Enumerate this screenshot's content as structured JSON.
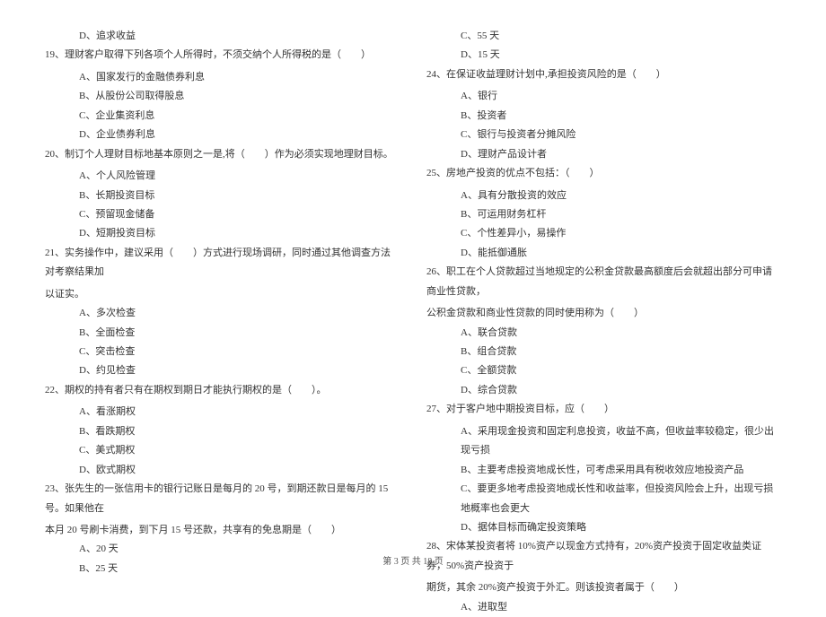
{
  "left_column": {
    "q18_d": "D、追求收益",
    "q19": "19、理财客户取得下列各项个人所得时，不须交纳个人所得税的是（　　）",
    "q19_a": "A、国家发行的金融债券利息",
    "q19_b": "B、从股份公司取得股息",
    "q19_c": "C、企业集资利息",
    "q19_d": "D、企业债券利息",
    "q20": "20、制订个人理财目标地基本原则之一是,将（　　）作为必须实现地理财目标。",
    "q20_a": "A、个人风险管理",
    "q20_b": "B、长期投资目标",
    "q20_c": "C、预留现金储备",
    "q20_d": "D、短期投资目标",
    "q21": "21、实务操作中，建议采用（　　）方式进行现场调研，同时通过其他调查方法对考察结果加",
    "q21_cont": "以证实。",
    "q21_a": "A、多次检查",
    "q21_b": "B、全面检查",
    "q21_c": "C、突击检查",
    "q21_d": "D、约见检查",
    "q22": "22、期权的持有者只有在期权到期日才能执行期权的是（　　）。",
    "q22_a": "A、看涨期权",
    "q22_b": "B、看跌期权",
    "q22_c": "C、美式期权",
    "q22_d": "D、欧式期权",
    "q23": "23、张先生的一张信用卡的银行记账日是每月的 20 号，到期还款日是每月的 15 号。如果他在",
    "q23_cont": "本月 20 号刷卡消费，到下月 15 号还款，共享有的免息期是（　　）",
    "q23_a": "A、20 天",
    "q23_b": "B、25 天"
  },
  "right_column": {
    "q23_c": "C、55 天",
    "q23_d": "D、15 天",
    "q24": "24、在保证收益理财计划中,承担投资风险的是（　　）",
    "q24_a": "A、银行",
    "q24_b": "B、投资者",
    "q24_c": "C、银行与投资者分摊风险",
    "q24_d": "D、理财产品设计者",
    "q25": "25、房地产投资的优点不包括：（　　）",
    "q25_a": "A、具有分散投资的效应",
    "q25_b": "B、可运用财务杠杆",
    "q25_c": "C、个性差异小，易操作",
    "q25_d": "D、能抵御通胀",
    "q26": "26、职工在个人贷款超过当地规定的公积金贷款最高额度后会就超出部分可申请商业性贷款，",
    "q26_cont": "公积金贷款和商业性贷款的同时使用称为（　　）",
    "q26_a": "A、联合贷款",
    "q26_b": "B、组合贷款",
    "q26_c": "C、全额贷款",
    "q26_d": "D、综合贷款",
    "q27": "27、对于客户地中期投资目标，应（　　）",
    "q27_a": "A、采用现金投资和固定利息投资，收益不高，但收益率较稳定，很少出现亏损",
    "q27_b": "B、主要考虑投资地成长性，可考虑采用具有税收效应地投资产品",
    "q27_c": "C、要更多地考虑投资地成长性和收益率，但投资风险会上升，出现亏损地概率也会更大",
    "q27_d": "D、据体目标而确定投资策略",
    "q28": "28、宋体某投资者将 10%资产以现金方式持有，20%资产投资于固定收益类证券，50%资产投资于",
    "q28_cont": "期货，其余 20%资产投资于外汇。则该投资者属于（　　）",
    "q28_a": "A、进取型"
  },
  "footer": "第 3 页 共 18 页"
}
